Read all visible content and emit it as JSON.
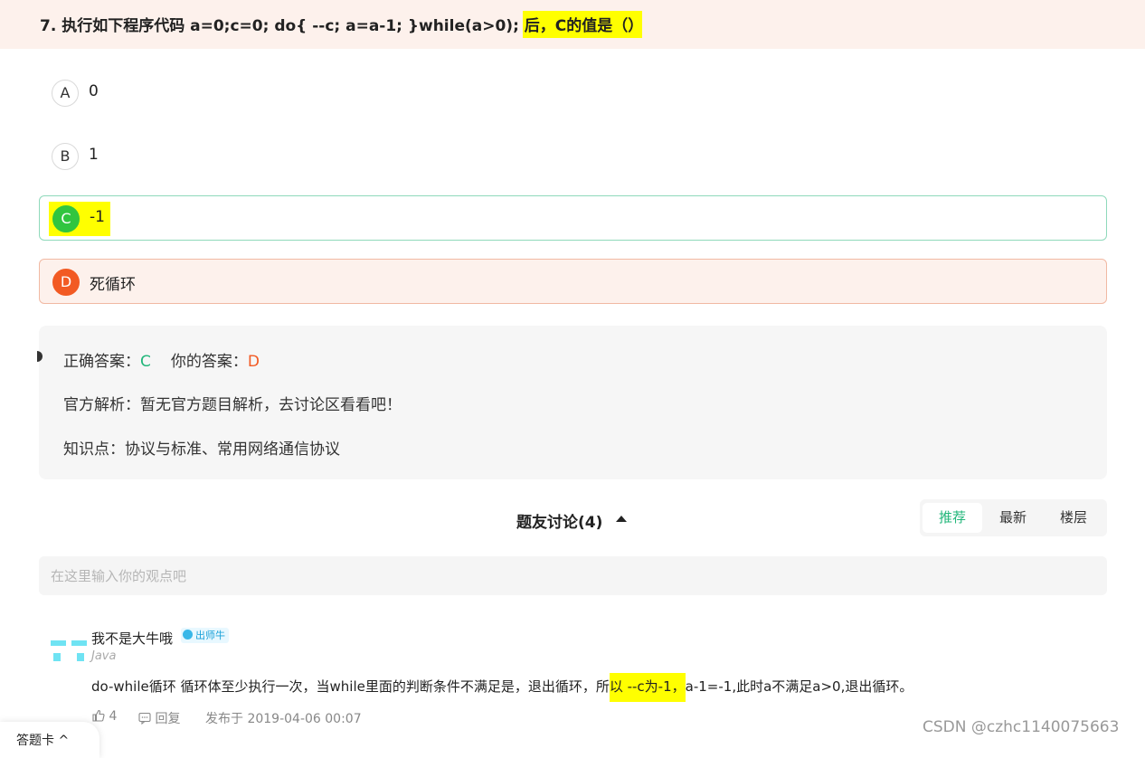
{
  "question": {
    "number_title": "7. 执行如下程序代码 a=0;c=0; do{ --c; a=a-1; }while(a>0); 后，C的值是（）"
  },
  "options": [
    {
      "letter": "A",
      "text": "0",
      "state": "default"
    },
    {
      "letter": "B",
      "text": "1",
      "state": "default"
    },
    {
      "letter": "C",
      "text": "-1",
      "state": "correct"
    },
    {
      "letter": "D",
      "text": "死循环",
      "state": "wrong"
    }
  ],
  "analysis": {
    "correct_label": "正确答案：",
    "correct_value": "C",
    "your_label": "你的答案：",
    "your_value": "D",
    "official": "官方解析：暂无官方题目解析，去讨论区看看吧！",
    "knowledge": "知识点：协议与标准、常用网络通信协议"
  },
  "discussion": {
    "title": "题友讨论(4)",
    "sort_tabs": [
      "推荐",
      "最新",
      "楼层"
    ],
    "active_tab": "推荐",
    "input_placeholder": "在这里输入你的观点吧"
  },
  "comment": {
    "username": "我不是大牛哦",
    "badge": "出师牛",
    "tag": "Java",
    "text_before": "do-while循环  循环体至少执行一次，当while里面的判断条件不满足是，退出循环，所",
    "text_highlight": "以 --c为-1，",
    "text_after": "a-1=-1,此时a不满足a>0,退出循环。",
    "likes": "4",
    "reply_label": "回复",
    "published": "发布于 2019-04-06 00:07"
  },
  "watermark": "CSDN @czhc1140075663",
  "answer_card_label": "答题卡",
  "colors": {
    "header_bg": "#fdf1ec",
    "correct": "#22b67a",
    "wrong": "#f25a23",
    "highlight": "#ffff00"
  }
}
